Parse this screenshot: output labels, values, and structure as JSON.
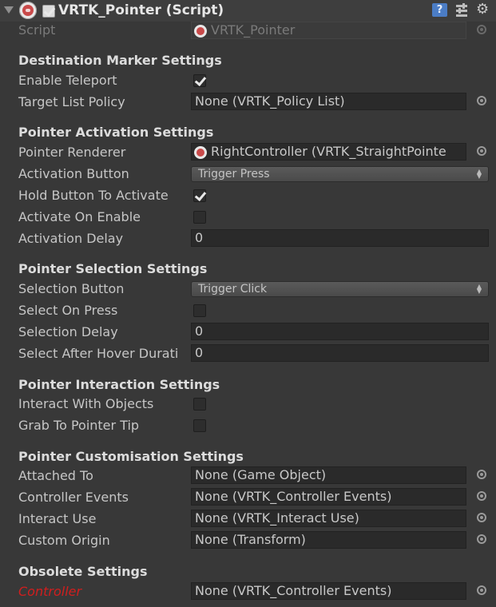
{
  "component": {
    "title": "VRTK_Pointer (Script)",
    "enabled": true,
    "script_label": "Script",
    "script_value": "VRTK_Pointer"
  },
  "sections": {
    "destination": {
      "heading": "Destination Marker Settings",
      "enable_teleport": {
        "label": "Enable Teleport",
        "checked": true
      },
      "target_list_policy": {
        "label": "Target List Policy",
        "value": "None (VRTK_Policy List)"
      }
    },
    "activation": {
      "heading": "Pointer Activation Settings",
      "pointer_renderer": {
        "label": "Pointer Renderer",
        "value": "RightController (VRTK_StraightPointe"
      },
      "activation_button": {
        "label": "Activation Button",
        "value": "Trigger Press"
      },
      "hold_button": {
        "label": "Hold Button To Activate",
        "checked": true
      },
      "activate_on_enable": {
        "label": "Activate On Enable",
        "checked": false
      },
      "activation_delay": {
        "label": "Activation Delay",
        "value": "0"
      }
    },
    "selection": {
      "heading": "Pointer Selection Settings",
      "selection_button": {
        "label": "Selection Button",
        "value": "Trigger Click"
      },
      "select_on_press": {
        "label": "Select On Press",
        "checked": false
      },
      "selection_delay": {
        "label": "Selection Delay",
        "value": "0"
      },
      "select_after_hover": {
        "label": "Select After Hover Durati",
        "value": "0"
      }
    },
    "interaction": {
      "heading": "Pointer Interaction Settings",
      "interact_with_objects": {
        "label": "Interact With Objects",
        "checked": false
      },
      "grab_to_pointer_tip": {
        "label": "Grab To Pointer Tip",
        "checked": false
      }
    },
    "customisation": {
      "heading": "Pointer Customisation Settings",
      "attached_to": {
        "label": "Attached To",
        "value": "None (Game Object)"
      },
      "controller_events": {
        "label": "Controller Events",
        "value": "None (VRTK_Controller Events)"
      },
      "interact_use": {
        "label": "Interact Use",
        "value": "None (VRTK_Interact Use)"
      },
      "custom_origin": {
        "label": "Custom Origin",
        "value": "None (Transform)"
      }
    },
    "obsolete": {
      "heading": "Obsolete Settings",
      "controller": {
        "label": "Controller",
        "value": "None (VRTK_Controller Events)"
      }
    }
  },
  "icons": {
    "help": "?",
    "gear": "⚙",
    "dropdown_arrow": "▲▼"
  },
  "colors": {
    "background": "#383838",
    "field": "#2a2a2a",
    "warning_label": "#d11e1e",
    "help_icon": "#4b7dc6"
  }
}
